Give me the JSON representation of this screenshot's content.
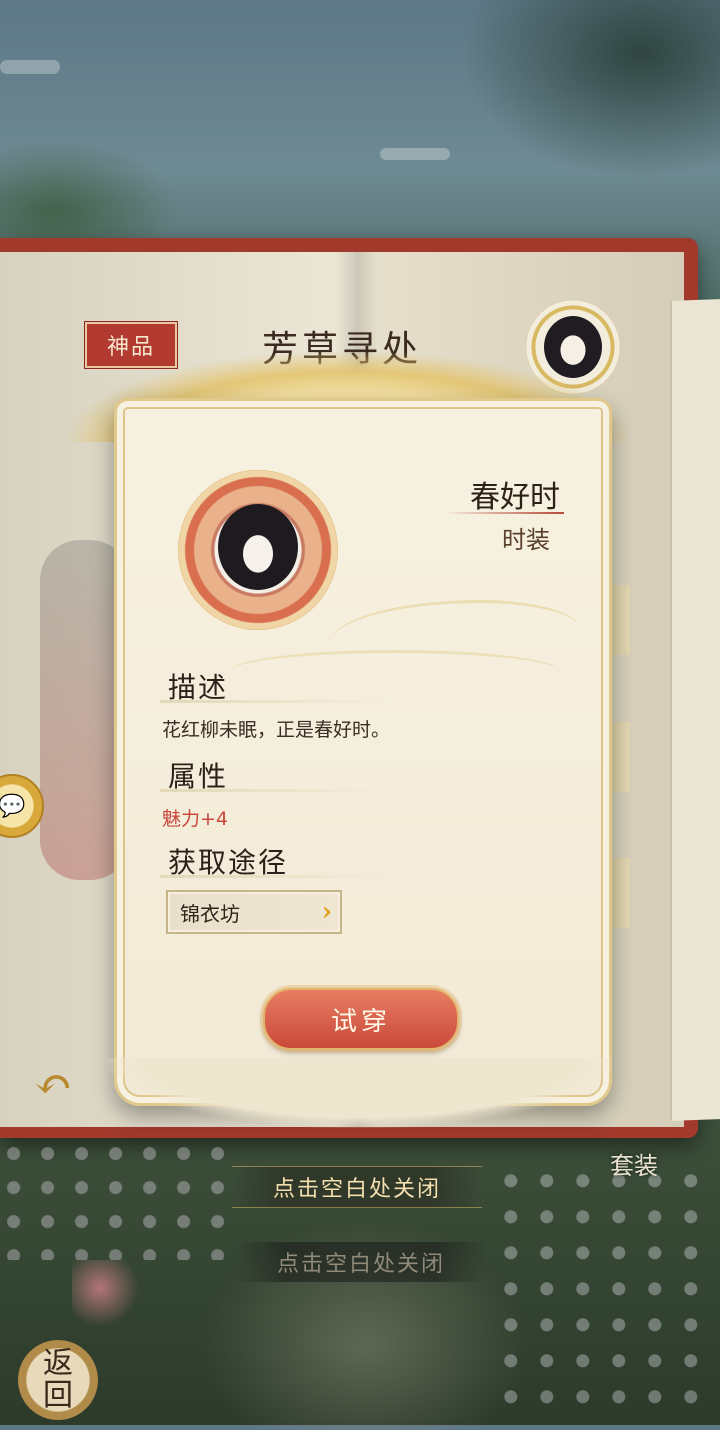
{
  "book": {
    "rank_badge": "神品",
    "title": "芳草寻处"
  },
  "modal": {
    "item_name": "春好时",
    "item_type": "时装",
    "description_heading": "描述",
    "description_text": "花红柳未眠，正是春好时。",
    "attributes_heading": "属性",
    "attribute_value": "魅力+4",
    "source_heading": "获取途径",
    "source_label": "锦衣坊",
    "source_arrow": "›",
    "try_on_label": "试穿"
  },
  "footer": {
    "close_hint": "点击空白处关闭",
    "close_hint_background": "点击空白处关闭",
    "suit_label": "套装",
    "return_label_1": "返",
    "return_label_2": "回"
  },
  "icons": {
    "back_arrow": "↶",
    "chat": "💬"
  },
  "colors": {
    "book_cover": "#a23a2c",
    "rank_badge": "#b33a31",
    "try_button": "#c9493a",
    "attribute_text": "#c9473b",
    "gold_accent": "#e2a21c"
  }
}
